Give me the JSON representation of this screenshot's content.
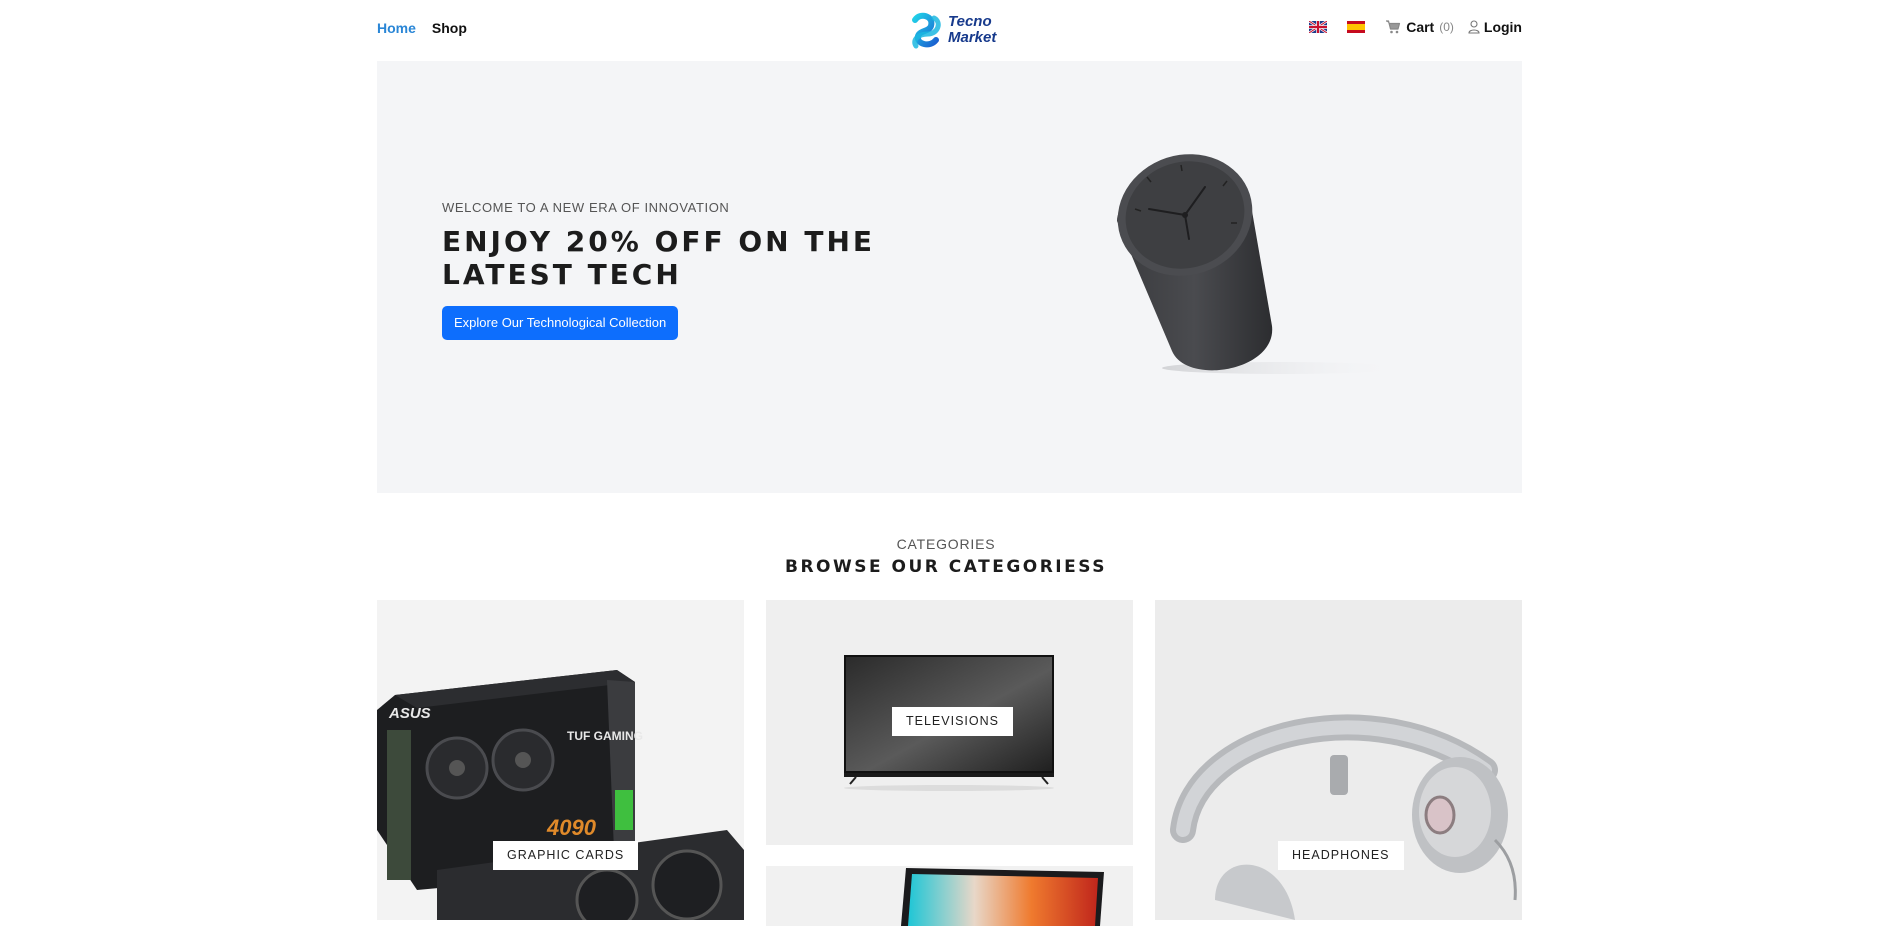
{
  "header": {
    "nav": [
      {
        "label": "Home",
        "active": true
      },
      {
        "label": "Shop",
        "active": false
      }
    ],
    "logo_text": [
      "Tecno",
      "Market"
    ],
    "languages": [
      "english-flag-icon",
      "spanish-flag-icon"
    ],
    "cart_label": "Cart",
    "cart_count": "(0)",
    "login_label": "Login"
  },
  "hero": {
    "kicker": "WELCOME TO A NEW ERA OF INNOVATION",
    "title_line1": "ENJOY 20% OFF ON THE",
    "title_line2": "LATEST TECH",
    "cta_label": "Explore Our Technological Collection"
  },
  "categories": {
    "kicker": "CATEGORIES",
    "title": "BROWSE OUR CATEGORIESS",
    "items": [
      {
        "label": "GRAPHIC CARDS",
        "icon": "graphics-card-image"
      },
      {
        "label": "TELEVISIONS",
        "icon": "television-image"
      },
      {
        "label": "HEADPHONES",
        "icon": "headphones-image"
      },
      {
        "label": "",
        "icon": "laptop-image"
      }
    ]
  },
  "colors": {
    "accent_link": "#2a86d6",
    "cta_blue": "#0d6efd",
    "hero_bg": "#f4f5f7",
    "logo_blue": "#173a8c",
    "logo_cyan": "#22c4e6"
  }
}
